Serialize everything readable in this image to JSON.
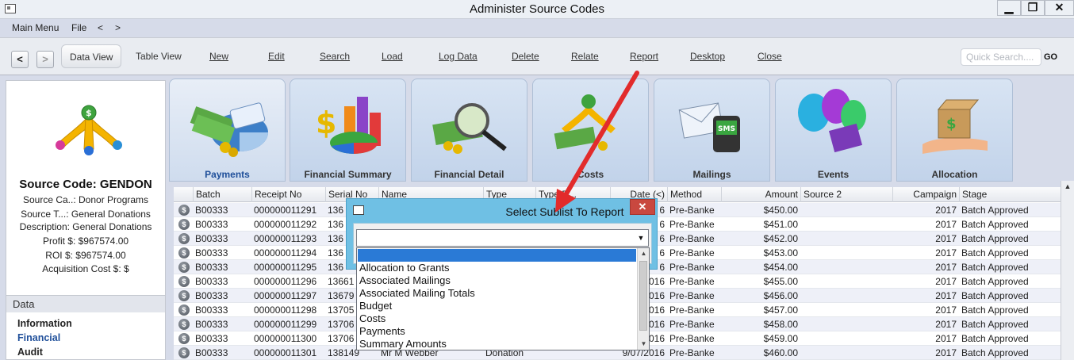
{
  "window": {
    "title": "Administer Source Codes",
    "minimize": "▁",
    "restore": "❐",
    "close": "✕"
  },
  "menu": {
    "items": [
      "Main Menu",
      "File",
      "<",
      ">"
    ]
  },
  "toolbar": {
    "back": "<",
    "forward": ">",
    "buttons": [
      "Data View",
      "Table View",
      "New",
      "Edit",
      "Search",
      "Load",
      "Log Data",
      "Delete",
      "Relate",
      "Report",
      "Desktop",
      "Close"
    ],
    "quick_search_placeholder": "Quick Search....",
    "go": "GO"
  },
  "summary": {
    "source_code": "Source Code: GENDON",
    "lines": [
      "Source Ca..: Donor Programs",
      "Source T...: General Donations",
      "Description: General Donations",
      "Profit $: $967574.00",
      "ROI $: $967574.00",
      "Acquisition Cost $: $"
    ]
  },
  "data_nav": {
    "header": "Data",
    "items": [
      "Information",
      "Financial",
      "Audit"
    ],
    "current": "Financial"
  },
  "tabs": [
    {
      "label": "Payments",
      "icon": "payments-icon"
    },
    {
      "label": "Financial Summary",
      "icon": "financial-summary-icon"
    },
    {
      "label": "Financial Detail",
      "icon": "financial-detail-icon"
    },
    {
      "label": "Costs",
      "icon": "costs-icon"
    },
    {
      "label": "Mailings",
      "icon": "mailings-icon"
    },
    {
      "label": "Events",
      "icon": "events-icon"
    },
    {
      "label": "Allocation",
      "icon": "allocation-icon"
    }
  ],
  "grid": {
    "columns": [
      "Batch",
      "Receipt No",
      "Serial No",
      "Name",
      "Type",
      "Type D...",
      "Date (<)",
      "Method",
      "Amount",
      "Source 2",
      "Campaign",
      "Stage"
    ],
    "rows": [
      {
        "batch": "B00333",
        "receipt": "000000011291",
        "serial": "136",
        "name": "",
        "type": "",
        "typed": "",
        "date": "6",
        "method": "Pre-Banke",
        "amount": "$450.00",
        "source2": "",
        "campaign": "2017",
        "stage": "Batch Approved"
      },
      {
        "batch": "B00333",
        "receipt": "000000011292",
        "serial": "136",
        "name": "",
        "type": "",
        "typed": "",
        "date": "6",
        "method": "Pre-Banke",
        "amount": "$451.00",
        "source2": "",
        "campaign": "2017",
        "stage": "Batch Approved"
      },
      {
        "batch": "B00333",
        "receipt": "000000011293",
        "serial": "136",
        "name": "",
        "type": "",
        "typed": "",
        "date": "6",
        "method": "Pre-Banke",
        "amount": "$452.00",
        "source2": "",
        "campaign": "2017",
        "stage": "Batch Approved"
      },
      {
        "batch": "B00333",
        "receipt": "000000011294",
        "serial": "136",
        "name": "",
        "type": "",
        "typed": "",
        "date": "6",
        "method": "Pre-Banke",
        "amount": "$453.00",
        "source2": "",
        "campaign": "2017",
        "stage": "Batch Approved"
      },
      {
        "batch": "B00333",
        "receipt": "000000011295",
        "serial": "136",
        "name": "",
        "type": "",
        "typed": "",
        "date": "6",
        "method": "Pre-Banke",
        "amount": "$454.00",
        "source2": "",
        "campaign": "2017",
        "stage": "Batch Approved"
      },
      {
        "batch": "B00333",
        "receipt": "000000011296",
        "serial": "13661",
        "name": "",
        "type": "",
        "typed": "",
        "date": "016",
        "method": "Pre-Banke",
        "amount": "$455.00",
        "source2": "",
        "campaign": "2017",
        "stage": "Batch Approved"
      },
      {
        "batch": "B00333",
        "receipt": "000000011297",
        "serial": "13679",
        "name": "",
        "type": "",
        "typed": "",
        "date": "016",
        "method": "Pre-Banke",
        "amount": "$456.00",
        "source2": "",
        "campaign": "2017",
        "stage": "Batch Approved"
      },
      {
        "batch": "B00333",
        "receipt": "000000011298",
        "serial": "13705",
        "name": "",
        "type": "",
        "typed": "",
        "date": "016",
        "method": "Pre-Banke",
        "amount": "$457.00",
        "source2": "",
        "campaign": "2017",
        "stage": "Batch Approved"
      },
      {
        "batch": "B00333",
        "receipt": "000000011299",
        "serial": "13706",
        "name": "",
        "type": "",
        "typed": "",
        "date": "016",
        "method": "Pre-Banke",
        "amount": "$458.00",
        "source2": "",
        "campaign": "2017",
        "stage": "Batch Approved"
      },
      {
        "batch": "B00333",
        "receipt": "000000011300",
        "serial": "13706",
        "name": "",
        "type": "",
        "typed": "",
        "date": "016",
        "method": "Pre-Banke",
        "amount": "$459.00",
        "source2": "",
        "campaign": "2017",
        "stage": "Batch Approved"
      },
      {
        "batch": "B00333",
        "receipt": "000000011301",
        "serial": "138149",
        "name": "Mr M Webber",
        "type": "Donation",
        "typed": "",
        "date": "9/07/2016",
        "method": "Pre-Banke",
        "amount": "$460.00",
        "source2": "",
        "campaign": "2017",
        "stage": "Batch Approved"
      }
    ]
  },
  "dialog": {
    "title": "Select Sublist To Report",
    "close": "✕",
    "combo_value": "",
    "options": [
      "Allocation to Grants",
      "Associated Mailings",
      "Associated Mailing Totals",
      "Budget",
      "Costs",
      "Payments",
      "Summary Amounts"
    ]
  }
}
